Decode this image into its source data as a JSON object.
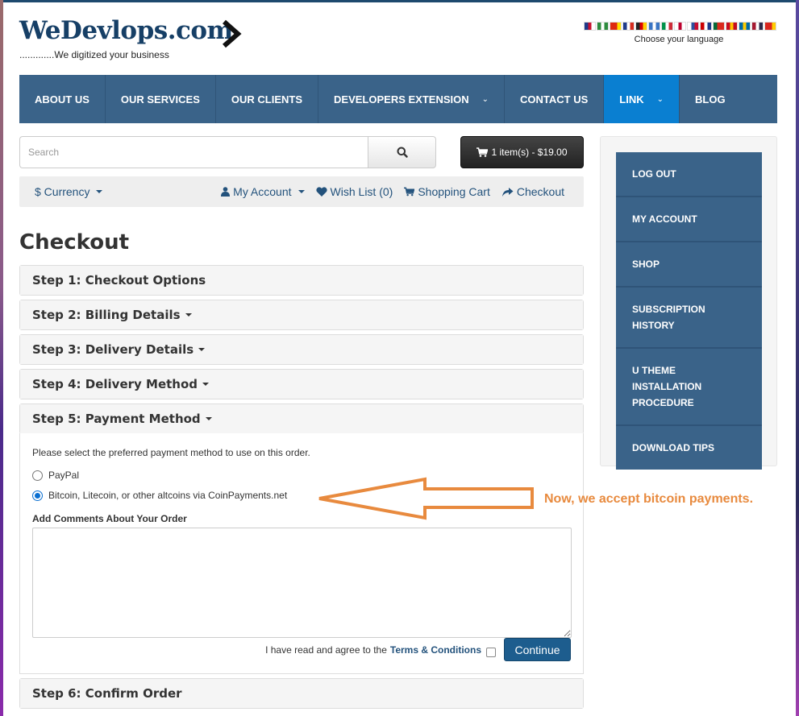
{
  "header": {
    "logo_text": "WeDevlops.com",
    "tagline": ".............We digitized your business",
    "language": {
      "label": "Choose your language",
      "flags": [
        {
          "name": "english",
          "colors": [
            "#1f3a8a",
            "#c8102e",
            "#ffffff"
          ]
        },
        {
          "name": "arabic",
          "colors": [
            "#2e8b3e",
            "#ffffff",
            "#2e8b3e"
          ]
        },
        {
          "name": "chinese",
          "colors": [
            "#de2910",
            "#de2910",
            "#ffde00"
          ]
        },
        {
          "name": "french",
          "colors": [
            "#1f3a8a",
            "#ffffff",
            "#d52b1e"
          ]
        },
        {
          "name": "german",
          "colors": [
            "#222222",
            "#dd0000",
            "#ffce00"
          ]
        },
        {
          "name": "greek",
          "colors": [
            "#3a75c4",
            "#ffffff",
            "#3a75c4"
          ]
        },
        {
          "name": "italian",
          "colors": [
            "#00924a",
            "#ffffff",
            "#ce2b37"
          ]
        },
        {
          "name": "japanese",
          "colors": [
            "#ffffff",
            "#bc002d",
            "#ffffff"
          ]
        },
        {
          "name": "korean",
          "colors": [
            "#ffffff",
            "#2c4f9e",
            "#c60c30"
          ]
        },
        {
          "name": "malay",
          "colors": [
            "#cc0001",
            "#ffffff",
            "#1f3a8a"
          ]
        },
        {
          "name": "portuguese",
          "colors": [
            "#046a38",
            "#da291c",
            "#da291c"
          ]
        },
        {
          "name": "spanish",
          "colors": [
            "#c60b1e",
            "#ffc400",
            "#c60b1e"
          ]
        },
        {
          "name": "swedish",
          "colors": [
            "#006aa7",
            "#fecc00",
            "#006aa7"
          ]
        },
        {
          "name": "thai",
          "colors": [
            "#a51931",
            "#ffffff",
            "#2d2a4a"
          ]
        },
        {
          "name": "vietnamese",
          "colors": [
            "#da251d",
            "#da251d",
            "#ffcd00"
          ]
        }
      ]
    }
  },
  "nav": {
    "items": [
      {
        "label": "ABOUT US",
        "dropdown": false,
        "active": false
      },
      {
        "label": "OUR SERVICES",
        "dropdown": false,
        "active": false
      },
      {
        "label": "OUR CLIENTS",
        "dropdown": false,
        "active": false
      },
      {
        "label": "DEVELOPERS EXTENSION",
        "dropdown": true,
        "active": false
      },
      {
        "label": "CONTACT US",
        "dropdown": false,
        "active": false
      },
      {
        "label": "LINK",
        "dropdown": true,
        "active": true
      },
      {
        "label": "BLOG",
        "dropdown": false,
        "active": false
      }
    ]
  },
  "search": {
    "placeholder": "Search",
    "value": ""
  },
  "cart": {
    "label": "1 item(s) - $19.00"
  },
  "toplinks": {
    "currency": "$ Currency",
    "my_account": "My Account",
    "wish_list": "Wish List (0)",
    "shopping_cart": "Shopping Cart",
    "checkout": "Checkout"
  },
  "checkout": {
    "title": "Checkout",
    "steps": [
      {
        "label": "Step 1: Checkout Options",
        "caret": false
      },
      {
        "label": "Step 2: Billing Details",
        "caret": true
      },
      {
        "label": "Step 3: Delivery Details",
        "caret": true
      },
      {
        "label": "Step 4: Delivery Method",
        "caret": true
      },
      {
        "label": "Step 5: Payment Method",
        "caret": true
      },
      {
        "label": "Step 6: Confirm Order",
        "caret": false
      }
    ],
    "payment": {
      "intro": "Please select the preferred payment method to use on this order.",
      "options": [
        {
          "label": "PayPal",
          "checked": false
        },
        {
          "label": "Bitcoin, Litecoin, or other altcoins via CoinPayments.net",
          "checked": true
        }
      ],
      "comments_label": "Add Comments About Your Order",
      "comments_value": "",
      "agree_text": "I have read and agree to the",
      "terms_link": "Terms & Conditions",
      "agree_checked": false,
      "continue_label": "Continue"
    }
  },
  "annotation": {
    "text": "Now, we accept bitcoin payments.",
    "color": "#e88a3e"
  },
  "sidebar": {
    "items": [
      {
        "label": "LOG OUT"
      },
      {
        "label": "MY ACCOUNT"
      },
      {
        "label": "SHOP"
      },
      {
        "label": "SUBSCRIPTION HISTORY"
      },
      {
        "label": "U THEME INSTALLATION PROCEDURE"
      },
      {
        "label": "DOWNLOAD TIPS"
      }
    ]
  },
  "colors": {
    "nav_bg": "#3a6389",
    "nav_active": "#0a7fd1",
    "link": "#23527c",
    "logo": "#163f66",
    "primary_button": "#1d5d8e"
  }
}
